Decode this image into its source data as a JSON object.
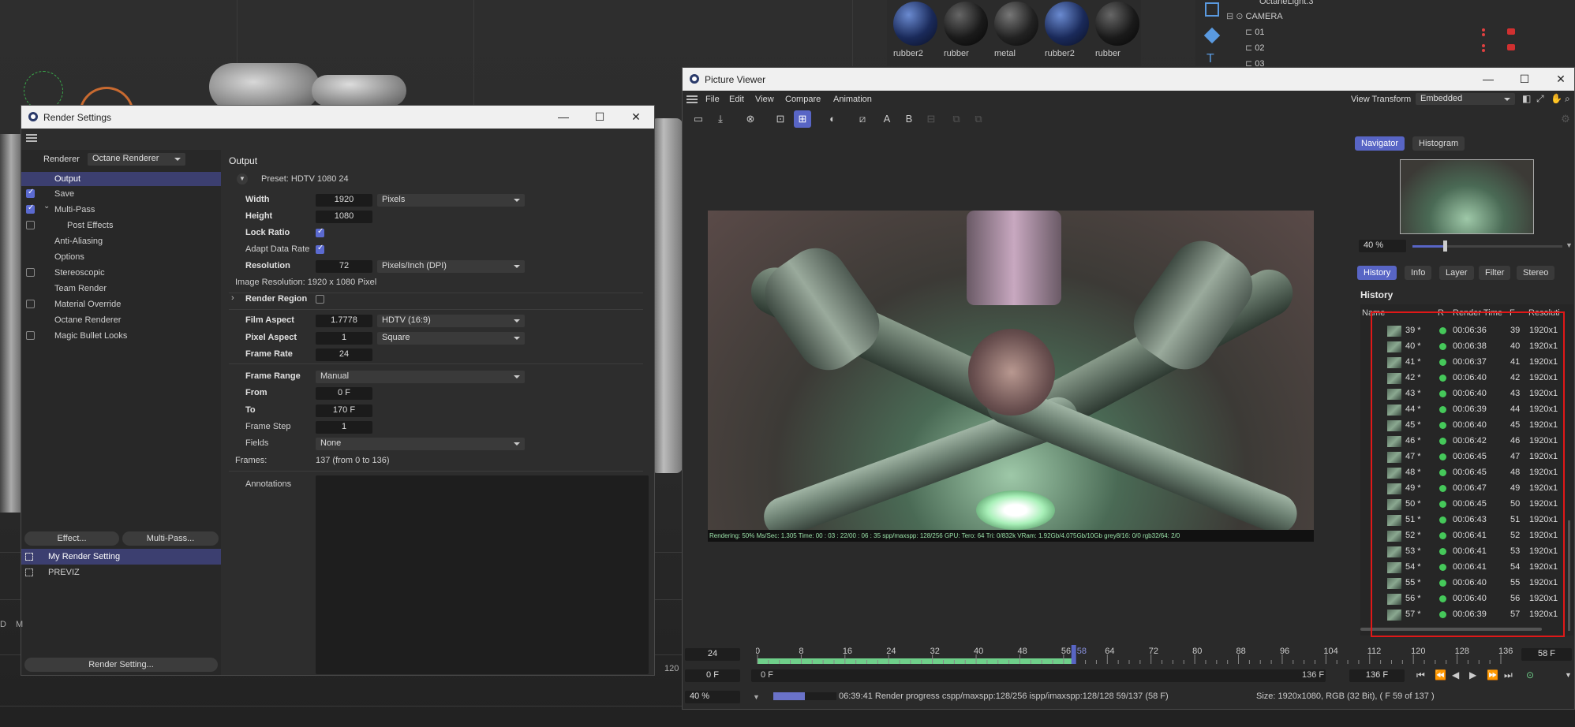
{
  "materials": [
    "rubber2",
    "rubber",
    "metal",
    "rubber2",
    "rubber"
  ],
  "objmgr": {
    "rows": [
      "OctaneLight.3",
      "CAMERA",
      "01",
      "02",
      "03"
    ]
  },
  "render_settings": {
    "title": "Render Settings",
    "renderer_label": "Renderer",
    "renderer_value": "Octane Renderer",
    "nav": [
      "Output",
      "Save",
      "Multi-Pass",
      "Post Effects",
      "Anti-Aliasing",
      "Options",
      "Stereoscopic",
      "Team Render",
      "Material Override",
      "Octane Renderer",
      "Magic Bullet Looks"
    ],
    "effect_btn": "Effect...",
    "multipass_btn": "Multi-Pass...",
    "settings_list": [
      "My Render Setting",
      "PREVIZ"
    ],
    "render_setting_btn": "Render Setting...",
    "section_title": "Output",
    "preset": "Preset: HDTV 1080 24",
    "width_label": "Width",
    "width_value": "1920",
    "width_unit": "Pixels",
    "height_label": "Height",
    "height_value": "1080",
    "lock_ratio": "Lock Ratio",
    "adapt_data_rate": "Adapt Data Rate",
    "resolution_label": "Resolution",
    "resolution_value": "72",
    "resolution_unit": "Pixels/Inch (DPI)",
    "image_resolution": "Image Resolution:  1920 x 1080 Pixel",
    "render_region": "Render Region",
    "film_aspect_label": "Film Aspect",
    "film_aspect_value": "1.7778",
    "film_aspect_preset": "HDTV (16:9)",
    "pixel_aspect_label": "Pixel Aspect",
    "pixel_aspect_value": "1",
    "pixel_aspect_preset": "Square",
    "frame_rate_label": "Frame Rate",
    "frame_rate_value": "24",
    "frame_range_label": "Frame Range",
    "frame_range_value": "Manual",
    "from_label": "From",
    "from_value": "0 F",
    "to_label": "To",
    "to_value": "170 F",
    "frame_step_label": "Frame Step",
    "frame_step_value": "1",
    "fields_label": "Fields",
    "fields_value": "None",
    "frames_label": "Frames:",
    "frames_value": "137 (from 0 to 136)",
    "annotations_label": "Annotations"
  },
  "picture_viewer": {
    "title": "Picture Viewer",
    "menu": [
      "File",
      "Edit",
      "View",
      "Compare",
      "Animation"
    ],
    "view_transform_label": "View Transform",
    "view_transform_value": "Embedded",
    "nav_tabs": [
      "Navigator",
      "Histogram"
    ],
    "zoom": "40 %",
    "info_tabs": [
      "History",
      "Info",
      "Layer",
      "Filter",
      "Stereo"
    ],
    "history_title": "History",
    "history_headers": [
      "Name",
      "R",
      "Render Time",
      "F",
      "Resoluti"
    ],
    "history_rows": [
      {
        "name": "39 *",
        "time": "00:06:36",
        "f": "39",
        "res": "1920x1"
      },
      {
        "name": "40 *",
        "time": "00:06:38",
        "f": "40",
        "res": "1920x1"
      },
      {
        "name": "41 *",
        "time": "00:06:37",
        "f": "41",
        "res": "1920x1"
      },
      {
        "name": "42 *",
        "time": "00:06:40",
        "f": "42",
        "res": "1920x1"
      },
      {
        "name": "43 *",
        "time": "00:06:40",
        "f": "43",
        "res": "1920x1"
      },
      {
        "name": "44 *",
        "time": "00:06:39",
        "f": "44",
        "res": "1920x1"
      },
      {
        "name": "45 *",
        "time": "00:06:40",
        "f": "45",
        "res": "1920x1"
      },
      {
        "name": "46 *",
        "time": "00:06:42",
        "f": "46",
        "res": "1920x1"
      },
      {
        "name": "47 *",
        "time": "00:06:45",
        "f": "47",
        "res": "1920x1"
      },
      {
        "name": "48 *",
        "time": "00:06:45",
        "f": "48",
        "res": "1920x1"
      },
      {
        "name": "49 *",
        "time": "00:06:47",
        "f": "49",
        "res": "1920x1"
      },
      {
        "name": "50 *",
        "time": "00:06:45",
        "f": "50",
        "res": "1920x1"
      },
      {
        "name": "51 *",
        "time": "00:06:43",
        "f": "51",
        "res": "1920x1"
      },
      {
        "name": "52 *",
        "time": "00:06:41",
        "f": "52",
        "res": "1920x1"
      },
      {
        "name": "53 *",
        "time": "00:06:41",
        "f": "53",
        "res": "1920x1"
      },
      {
        "name": "54 *",
        "time": "00:06:41",
        "f": "54",
        "res": "1920x1"
      },
      {
        "name": "55 *",
        "time": "00:06:40",
        "f": "55",
        "res": "1920x1"
      },
      {
        "name": "56 *",
        "time": "00:06:40",
        "f": "56",
        "res": "1920x1"
      },
      {
        "name": "57 *",
        "time": "00:06:39",
        "f": "57",
        "res": "1920x1"
      }
    ],
    "stats_line": "Rendering: 50%  Ms/Sec: 1.305  Time: 00 : 03 : 22/00 : 06 : 35  spp/maxspp: 128/256  GPU:    Tero: 64  Tri: 0/832k  VRam: 1.92Gb/4.075Gb/10Gb  grey8/16: 0/0  rgb32/64: 2/0",
    "fps": "24",
    "timeline_ticks": [
      "0",
      "8",
      "16",
      "24",
      "32",
      "40",
      "48",
      "56",
      "58",
      "64",
      "72",
      "80",
      "88",
      "96",
      "104",
      "112",
      "120",
      "128",
      "136"
    ],
    "timeline_ticks_text": "0 8 16 24 32 40 48 56 58 64 72 80 88 96 104 112 120 128 136",
    "current_frame": "58 F",
    "start_frame": "0 F",
    "range_start": "0 F",
    "range_end": "136 F",
    "range_end2": "136 F",
    "bottom_zoom": "40 %",
    "status_progress": "06:39:41 Render progress   cspp/maxspp:128/256   ispp/imaxspp:128/128 59/137 (58 F)",
    "status_size": "Size: 1920x1080, RGB (32 Bit),  ( F 59 of 137 )",
    "render_progress_fraction": 0.5
  },
  "colors": {
    "accent": "#5865c5",
    "highlight_box": "#e01818",
    "status_dot": "#45c85a",
    "timeline_green": "#6fd08a"
  },
  "edge_labels": {
    "left_a": "D",
    "left_b": "M",
    "right_num": "120"
  }
}
